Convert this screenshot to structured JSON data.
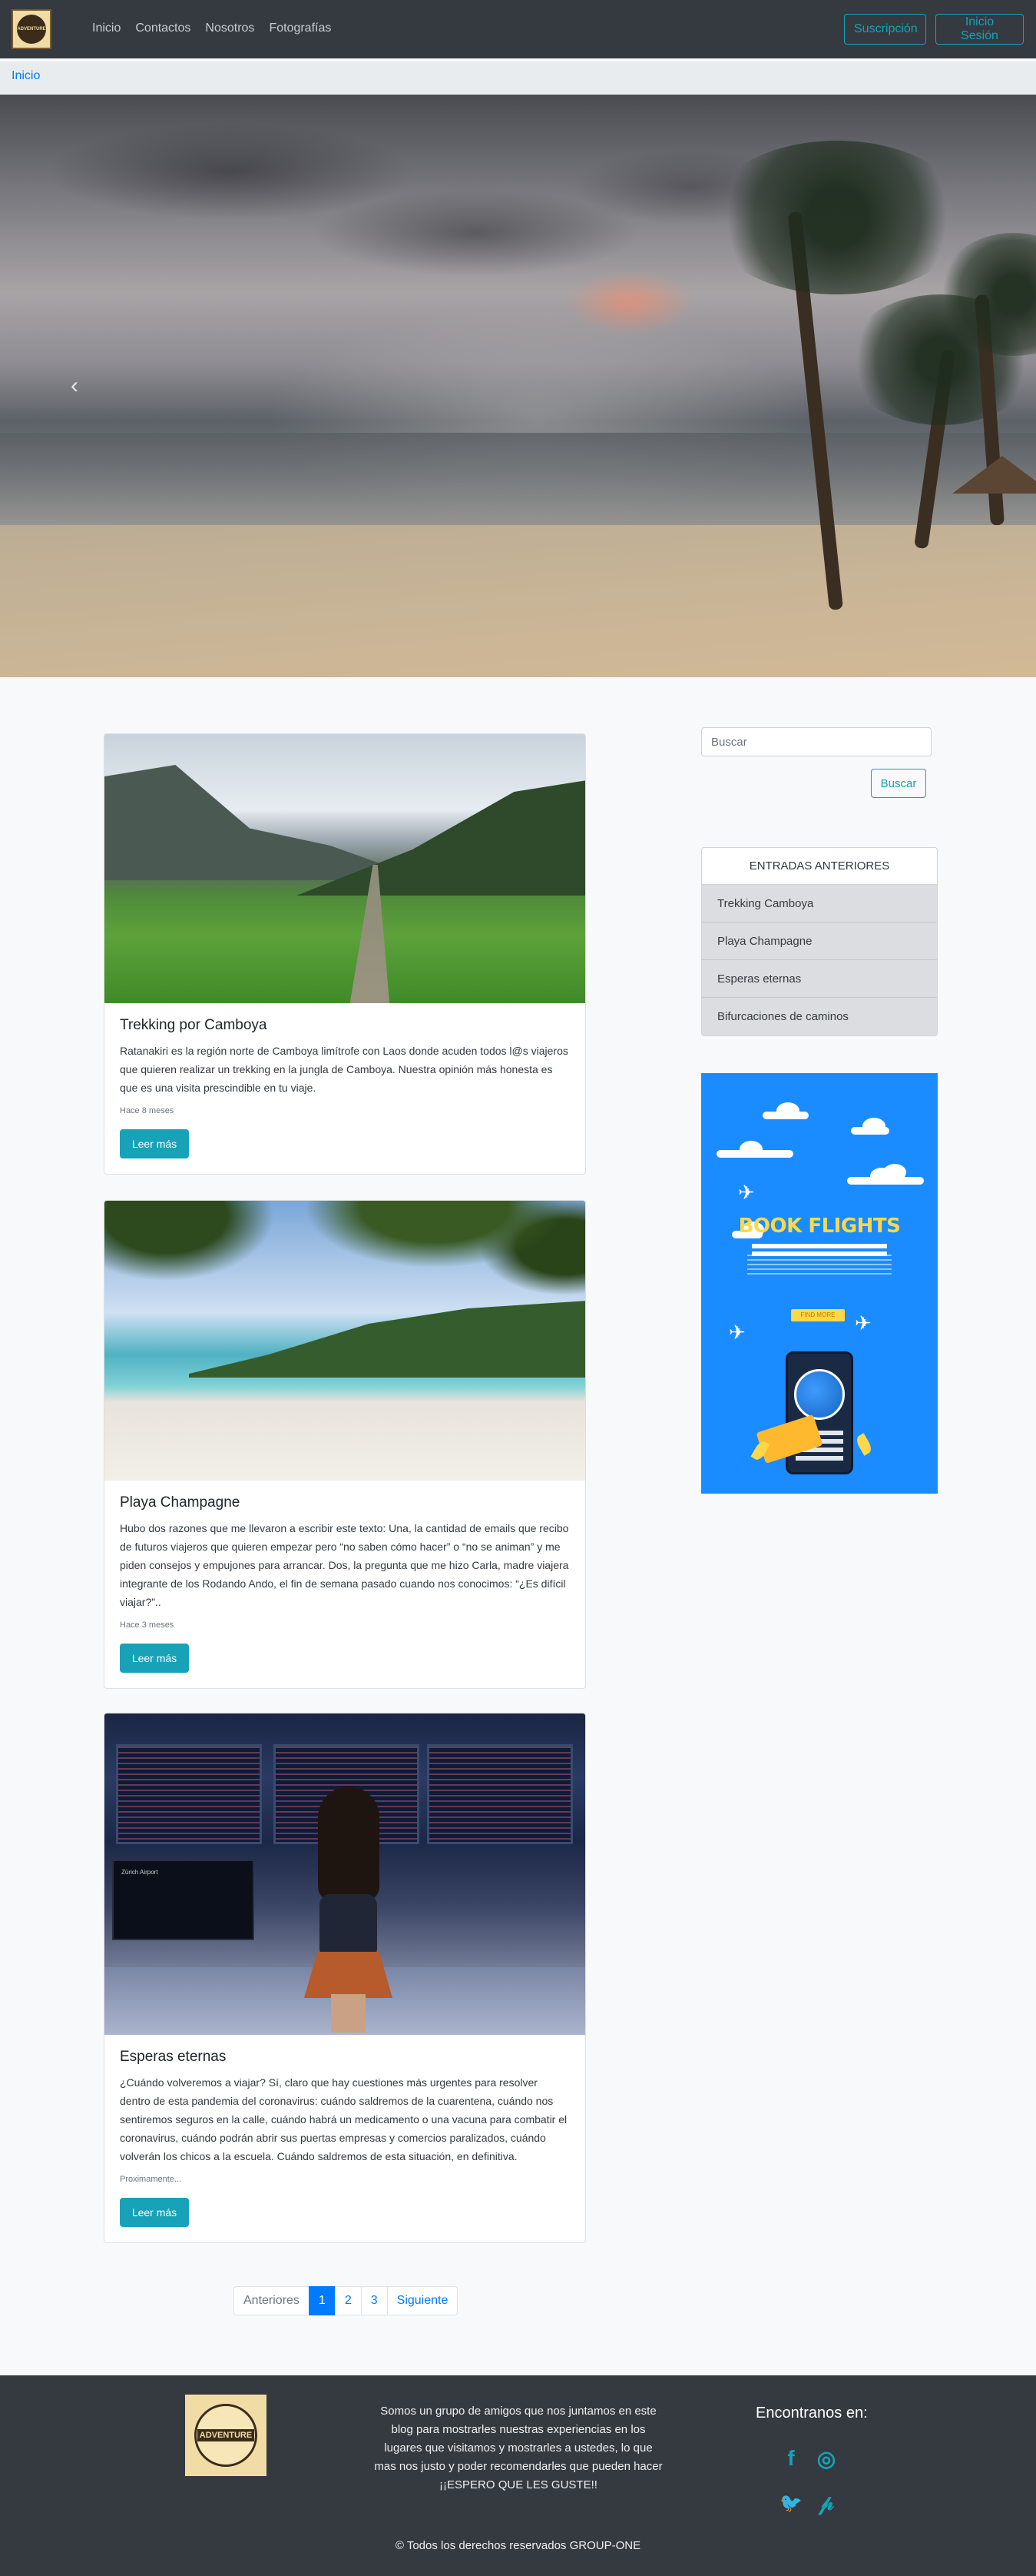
{
  "brand": {
    "logo_alt": "ADVENTURE"
  },
  "nav": {
    "links": [
      "Inicio",
      "Contactos",
      "Nosotros",
      "Fotografías"
    ],
    "subscribe_label": "Suscripción",
    "login_label": "Inicio Sesión"
  },
  "breadcrumb": {
    "home": "Inicio"
  },
  "hero": {
    "prev_icon": "chevron-left-icon",
    "prev_glyph": "‹"
  },
  "posts": [
    {
      "title": "Trekking por Camboya",
      "text": "Ratanakiri es la región norte de Camboya limítrofe con Laos donde acuden todos l@s viajeros que quieren realizar un trekking en la jungla de Camboya. Nuestra opinión más honesta es que es una visita prescindible en tu viaje.",
      "time": "Hace 8 meses",
      "button": "Leer más"
    },
    {
      "title": "Playa Champagne",
      "text": "Hubo dos razones que me llevaron a escribir este texto: Una, la cantidad de emails que recibo de futuros viajeros que quieren empezar pero “no saben cómo hacer” o “no se animan” y me piden consejos y empujones para arrancar. Dos, la pregunta que me hizo Carla, madre viajera integrante de los Rodando Ando, el fin de semana pasado cuando nos conocimos: “¿Es difícil viajar?”..",
      "time": "Hace 3 meses",
      "button": "Leer más"
    },
    {
      "title": "Esperas eternas",
      "text": "¿Cuándo volveremos a viajar? Sí, claro que hay cuestiones más urgentes para resolver dentro de esta pandemia del coronavirus: cuándo saldremos de la cuarentena, cuándo nos sentiremos seguros en la calle, cuándo habrá un medicamento o una vacuna para combatir el coronavirus, cuándo podrán abrir sus puertas empresas y comercios paralizados, cuándo volverán los chicos a la escuela. Cuándo saldremos de esta situación, en definitiva.",
      "time": "Proximamente...",
      "button": "Leer más",
      "screen_text": "Zürich Airport"
    }
  ],
  "pagination": {
    "prev": "Anteriores",
    "pages": [
      "1",
      "2",
      "3"
    ],
    "active_page": "1",
    "next": "Siguiente"
  },
  "sidebar": {
    "search_placeholder": "Buscar",
    "search_button": "Buscar",
    "entries_header": "ENTRADAS ANTERIORES",
    "entries": [
      "Trekking Camboya",
      "Playa Champagne",
      "Esperas eternas",
      "Bifurcaciones de caminos"
    ],
    "ad": {
      "title": "BOOK FLIGHTS",
      "button": "FIND MORE"
    }
  },
  "footer": {
    "about": "Somos un grupo de amigos que nos juntamos en este blog para mostrarles nuestras experiencias en los lugares que visitamos y mostrarles a ustedes, lo que mas nos justo y poder recomendarles que pueden hacer",
    "about_emphasis": "¡¡ESPERO QUE LES GUSTE!!",
    "find_us": "Encontranos en:",
    "social": [
      {
        "icon": "facebook-icon",
        "glyph": "f"
      },
      {
        "icon": "instagram-icon",
        "glyph": "◎"
      },
      {
        "icon": "twitter-icon",
        "glyph": "🐦"
      },
      {
        "icon": "pinterest-icon",
        "glyph": "𝓅"
      }
    ],
    "copyright": "© Todos los derechos reservados GROUP-ONE",
    "logo_text": "ADVENTURE"
  },
  "colors": {
    "navbar": "#343a40",
    "accent": "#17a2b8",
    "link": "#007bff",
    "ad_bg": "#1a8cff",
    "ad_title": "#ffd84a"
  }
}
